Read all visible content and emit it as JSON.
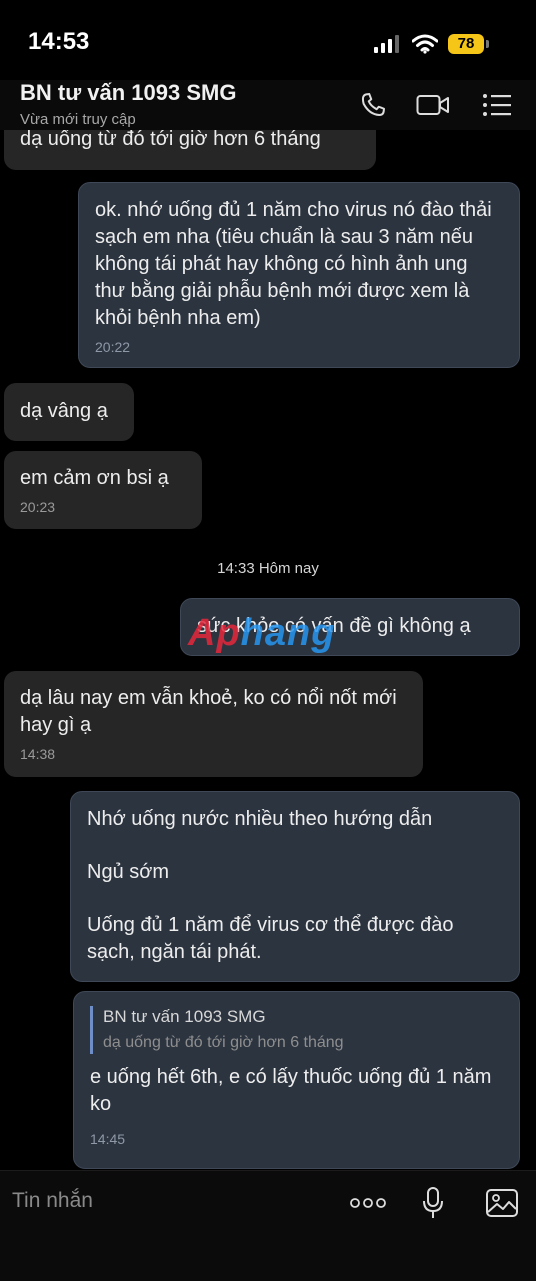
{
  "status_bar": {
    "time": "14:53",
    "battery": "78",
    "icons": [
      "signal-icon",
      "wifi-icon",
      "battery-icon"
    ]
  },
  "header": {
    "title": "BN tư vấn 1093 SMG",
    "subtitle": "Vừa mới truy cập",
    "icons": [
      "phone-icon",
      "video-call-icon",
      "menu-icon"
    ]
  },
  "messages": [
    {
      "id": "m0",
      "direction": "incoming",
      "text": "dạ uống từ đó tới giờ hơn 6 tháng",
      "time": ""
    },
    {
      "id": "m1",
      "direction": "outgoing",
      "text": "ok. nhớ uống đủ 1 năm cho virus nó đào thải sạch em nha (tiêu chuẩn là sau 3 năm nếu không tái phát hay không có hình ảnh ung thư bằng giải phẫu bệnh mới được xem là khỏi bệnh nha em)",
      "time": "20:22"
    },
    {
      "id": "m2",
      "direction": "incoming",
      "text": "dạ vâng ạ",
      "time": ""
    },
    {
      "id": "m3",
      "direction": "incoming",
      "text": "em cảm ơn bsi ạ",
      "time": "20:23"
    },
    {
      "id": "m4",
      "direction": "outgoing",
      "text": "sức khỏe có vấn đề gì không ạ",
      "time": ""
    },
    {
      "id": "m5",
      "direction": "incoming",
      "text": "dạ lâu nay em vẫn khoẻ, ko có nổi nốt mới hay gì ạ",
      "time": "14:38"
    },
    {
      "id": "m6",
      "direction": "outgoing",
      "lines": [
        "Nhớ uống nước nhiều theo hướng dẫn",
        "Ngủ sớm",
        "Uống đủ 1 năm để virus cơ thể được đào sạch, ngăn tái phát."
      ],
      "time": ""
    },
    {
      "id": "m7",
      "direction": "outgoing",
      "quote": {
        "name": "BN tư vấn 1093 SMG",
        "text": "dạ uống từ đó tới giờ hơn 6 tháng"
      },
      "text": "e uống hết 6th, e có lấy thuốc uống đủ 1 năm ko",
      "time": "14:45"
    }
  ],
  "date_separator": "14:33 Hôm nay",
  "watermark": {
    "part1": "Ap",
    "part2": "hang"
  },
  "input": {
    "placeholder": "Tin nhắn",
    "icons": [
      "more-icon",
      "microphone-icon",
      "image-icon"
    ]
  },
  "colors": {
    "background": "#000000",
    "incoming_bubble": "#262626",
    "outgoing_bubble": "#2c3440",
    "battery": "#f5c518"
  }
}
